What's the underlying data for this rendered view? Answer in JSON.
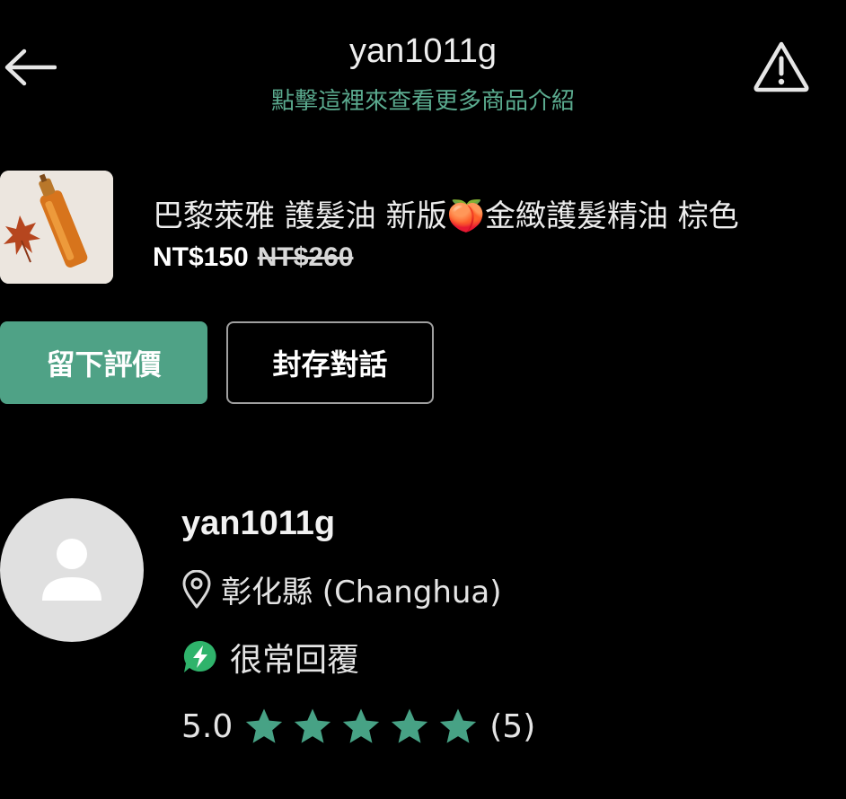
{
  "header": {
    "title": "yan1011g",
    "subtitle": "點擊這裡來查看更多商品介紹",
    "back_icon": "arrow-left-icon",
    "report_icon": "warning-triangle-icon"
  },
  "product": {
    "title": "巴黎萊雅 護髮油 新版🍑金緻護髮精油 棕色",
    "price": "NT$150",
    "original_price": "NT$260"
  },
  "actions": {
    "review_label": "留下評價",
    "archive_label": "封存對話"
  },
  "seller": {
    "name": "yan1011g",
    "location": "彰化縣 (Changhua)",
    "response": "很常回覆",
    "rating": "5.0",
    "stars": 5,
    "review_count": "(5)"
  },
  "colors": {
    "accent": "#4fa286",
    "subtitle": "#5bab8f",
    "background": "#000000"
  }
}
